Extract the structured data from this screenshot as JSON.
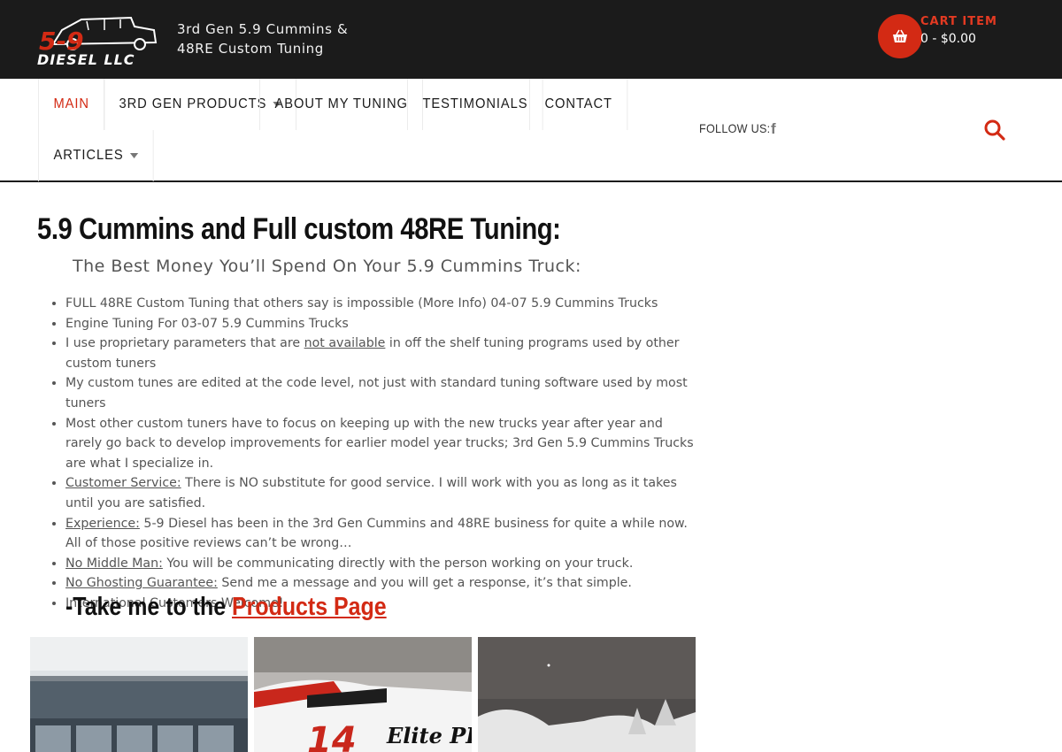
{
  "header": {
    "logo_text": "5-9 DIESEL LLC",
    "tagline_line1": "3rd Gen 5.9 Cummins &",
    "tagline_line2": "48RE Custom Tuning",
    "cart_label": "CART ITEM",
    "cart_total": "0 - $0.00"
  },
  "nav": {
    "items": [
      {
        "label": "MAIN",
        "active": true
      },
      {
        "label": "3RD GEN PRODUCTS",
        "dropdown": true
      },
      {
        "label": "ABOUT MY TUNING"
      },
      {
        "label": "TESTIMONIALS"
      },
      {
        "label": "CONTACT"
      },
      {
        "label": "ARTICLES",
        "dropdown": true
      }
    ],
    "follow_label": "FOLLOW US:",
    "social_icon": "facebook-icon"
  },
  "content": {
    "heading": "5.9 Cummins and Full custom 48RE Tuning:",
    "subtitle": "The Best Money You’ll Spend On Your 5.9 Cummins Truck:",
    "bullets": [
      {
        "text": "FULL 48RE Custom Tuning that others say is impossible (More Info) 04-07 5.9 Cummins Trucks"
      },
      {
        "text": "Engine Tuning For 03-07 5.9 Cummins Trucks"
      },
      {
        "pre": "I use proprietary parameters that are ",
        "underline": "not available",
        "post": " in off the shelf tuning programs used by other custom tuners"
      },
      {
        "text": "My custom tunes are edited at the code level, not just with standard tuning software used by most tuners"
      },
      {
        "text": "Most other custom tuners have to focus on keeping up with the new trucks year after year and rarely go back to develop improvements for earlier model year trucks; 3rd Gen 5.9 Cummins Trucks are what I specialize in."
      },
      {
        "underline": "Customer Service:",
        "post": " There is NO substitute for good service. I will work with you as long as it takes until you are satisfied."
      },
      {
        "underline": "Experience:",
        "post": " 5-9 Diesel has been in the 3rd Gen Cummins and 48RE business for quite a while now.  All of those positive reviews can’t be wrong…"
      },
      {
        "underline": "No Middle Man:",
        "post": "  You will be communicating directly with the person working on your truck."
      },
      {
        "underline": "No Ghosting Guarantee:",
        "post": " Send me a message and you will get a response, it’s that simple."
      },
      {
        "text": "International Customers Welcome!"
      }
    ],
    "cta_prefix": "-Take me to the ",
    "cta_link": "Products Page"
  },
  "photos": {
    "car_text": "Elite PETRO",
    "car_number": "14"
  },
  "colors": {
    "accent": "#d32a14",
    "topbar": "#1b1b1b"
  }
}
